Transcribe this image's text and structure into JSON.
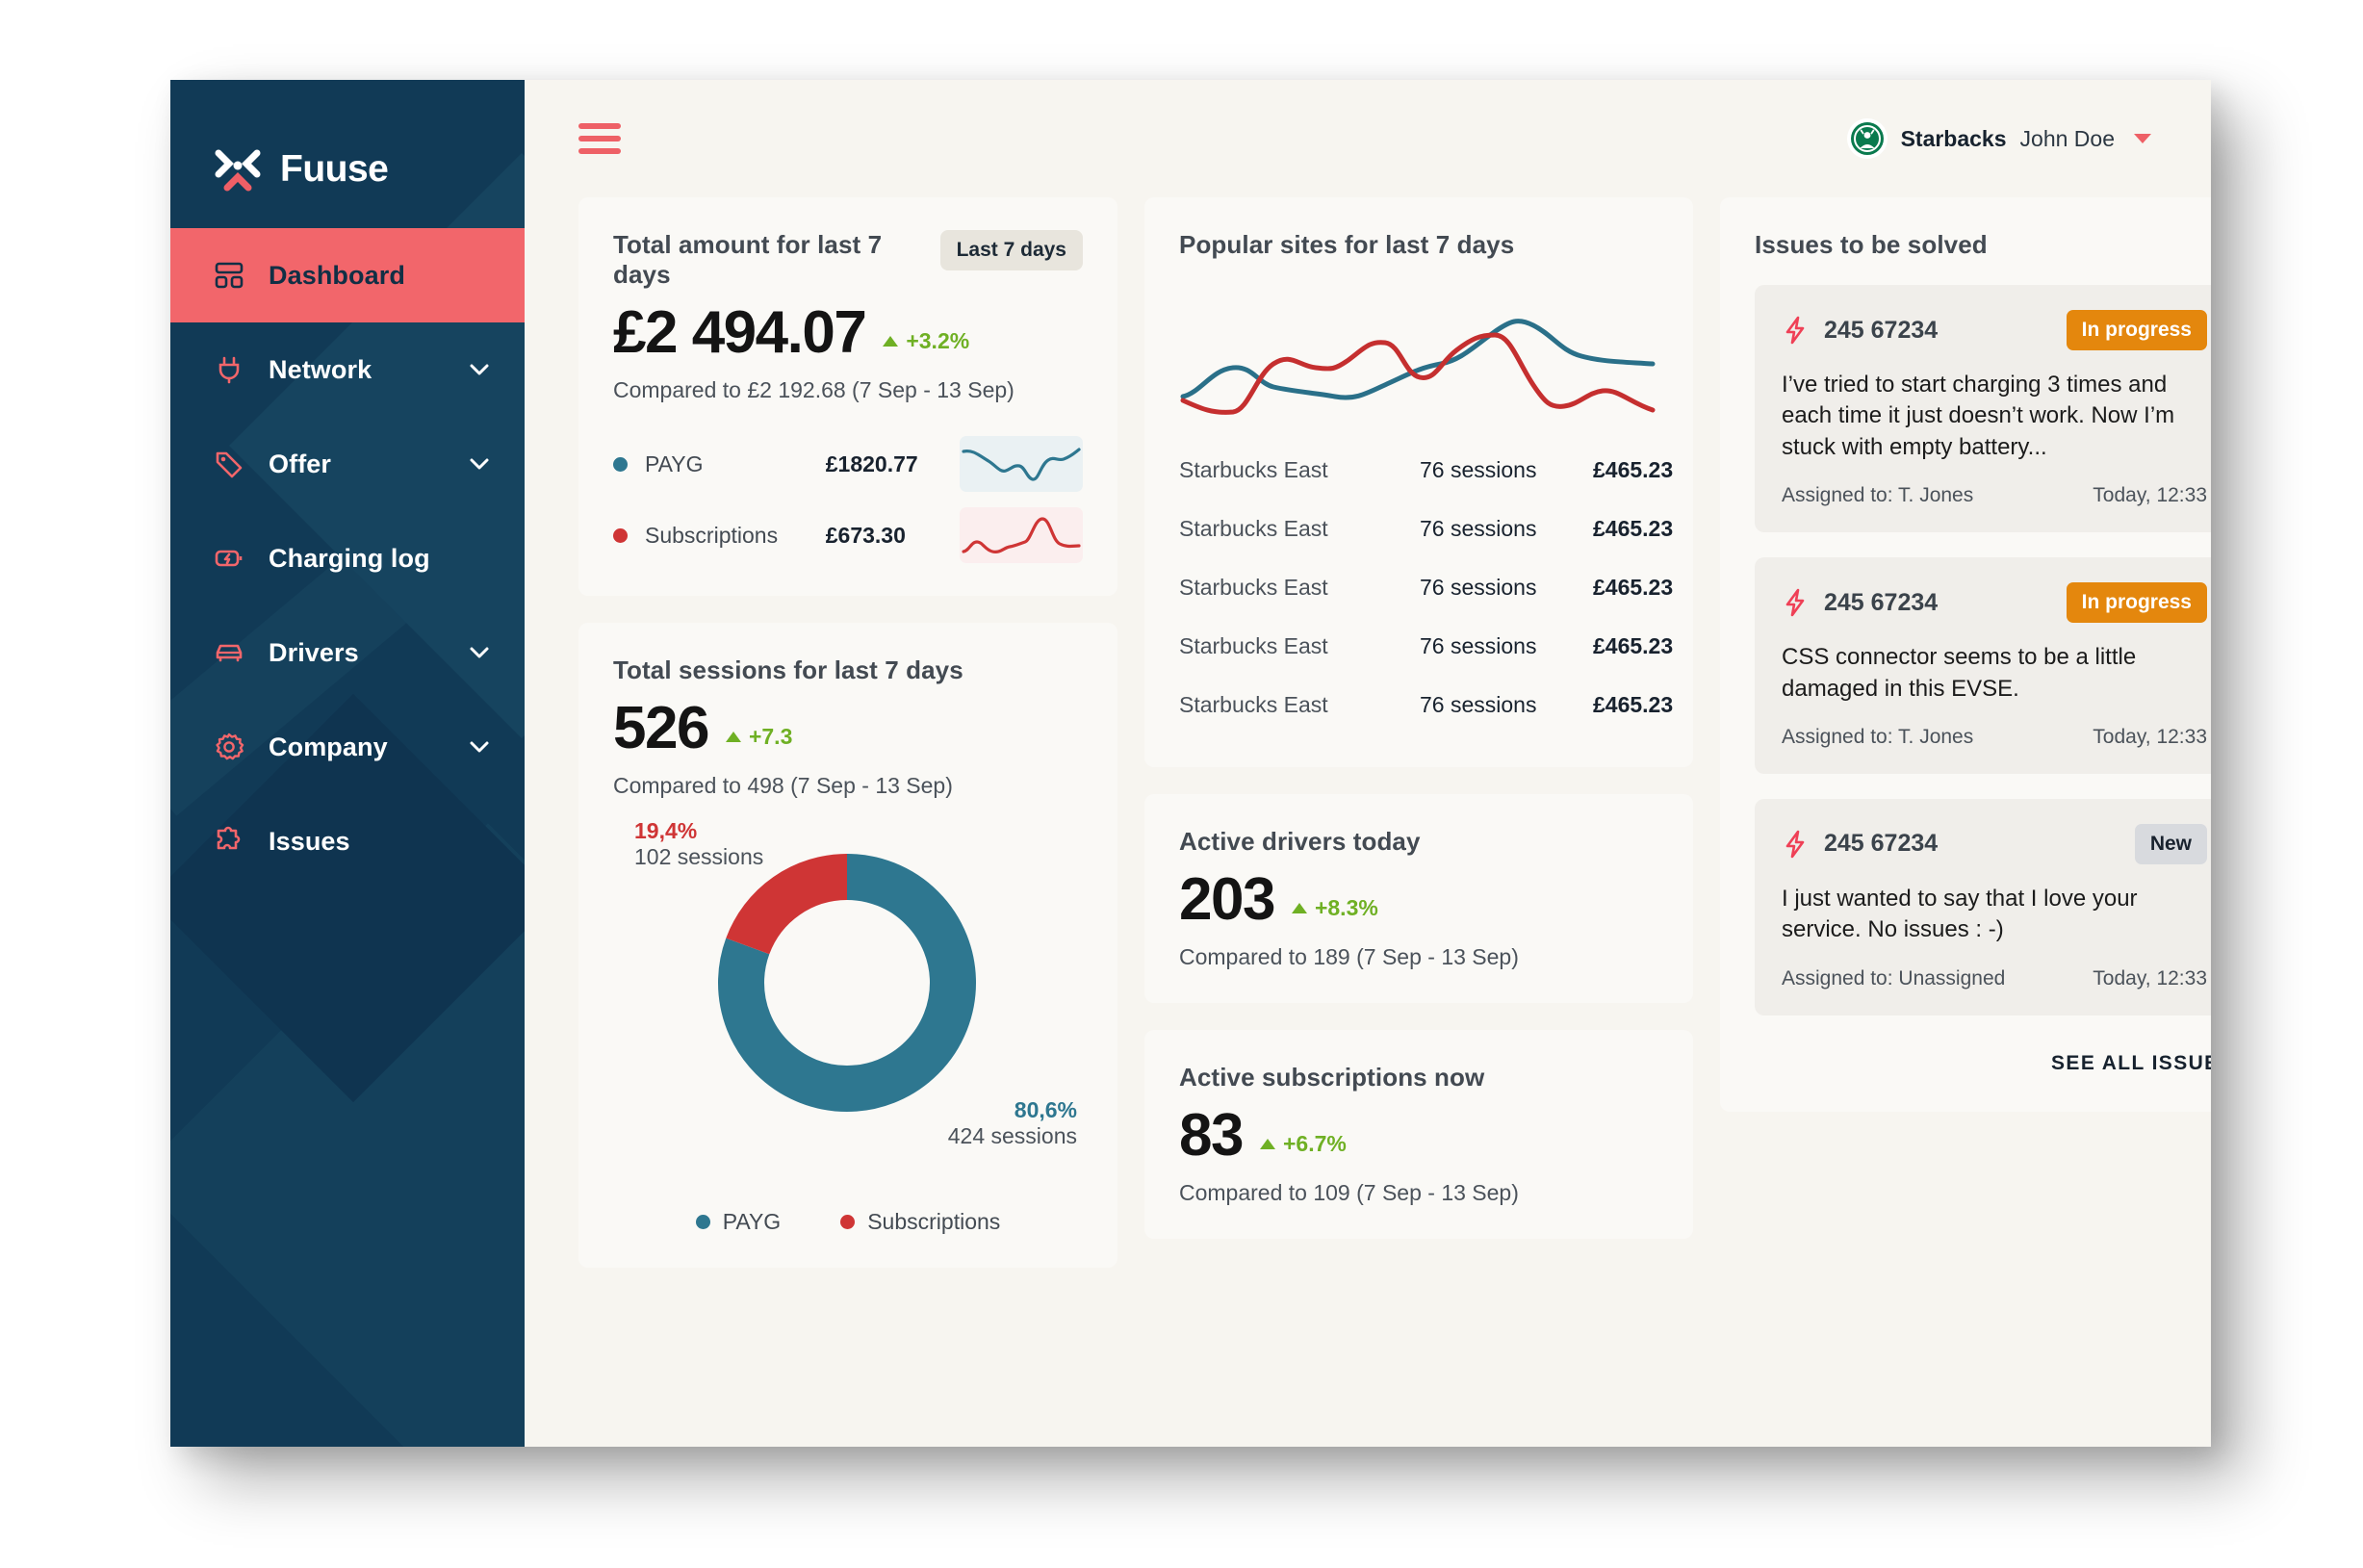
{
  "brand": {
    "name": "Fuuse",
    "logo_icon": "fuuse-x-logo"
  },
  "sidebar": {
    "items": [
      {
        "label": "Dashboard",
        "icon": "dashboard-grid-icon",
        "active": true,
        "expandable": false
      },
      {
        "label": "Network",
        "icon": "plug-icon",
        "active": false,
        "expandable": true
      },
      {
        "label": "Offer",
        "icon": "tag-icon",
        "active": false,
        "expandable": true
      },
      {
        "label": "Charging log",
        "icon": "battery-bolt-icon",
        "active": false,
        "expandable": false
      },
      {
        "label": "Drivers",
        "icon": "car-icon",
        "active": false,
        "expandable": true
      },
      {
        "label": "Company",
        "icon": "gear-icon",
        "active": false,
        "expandable": true
      },
      {
        "label": "Issues",
        "icon": "puzzle-icon",
        "active": false,
        "expandable": false
      }
    ]
  },
  "topbar": {
    "menu_icon": "hamburger-icon",
    "org": "Starbacks",
    "user": "John Doe",
    "avatar_icon": "starbucks-avatar"
  },
  "total_amount": {
    "title": "Total amount for last 7 days",
    "range_chip": "Last 7 days",
    "value": "£2 494.07",
    "delta": "+3.2%",
    "compared": "Compared to £2 192.68 (7 Sep - 13 Sep)",
    "breakdown": [
      {
        "name": "PAYG",
        "value": "£1820.77",
        "color": "#2e7790"
      },
      {
        "name": "Subscriptions",
        "value": "£673.30",
        "color": "#cf3535"
      }
    ]
  },
  "total_sessions": {
    "title": "Total sessions for last 7 days",
    "value": "526",
    "delta": "+7.3",
    "compared": "Compared to 498 (7 Sep - 13 Sep)",
    "labels": {
      "top_pct": "19,4%",
      "top_sessions": "102 sessions",
      "bottom_pct": "80,6%",
      "bottom_sessions": "424 sessions"
    },
    "legend": [
      {
        "name": "PAYG",
        "color": "#2e7790"
      },
      {
        "name": "Subscriptions",
        "color": "#cf3535"
      }
    ]
  },
  "popular_sites": {
    "title": "Popular sites for last 7 days",
    "rows": [
      {
        "site": "Starbucks East",
        "sessions": "76 sessions",
        "amount": "£465.23"
      },
      {
        "site": "Starbucks East",
        "sessions": "76 sessions",
        "amount": "£465.23"
      },
      {
        "site": "Starbucks East",
        "sessions": "76 sessions",
        "amount": "£465.23"
      },
      {
        "site": "Starbucks East",
        "sessions": "76 sessions",
        "amount": "£465.23"
      },
      {
        "site": "Starbucks East",
        "sessions": "76 sessions",
        "amount": "£465.23"
      }
    ]
  },
  "active_drivers": {
    "title": "Active drivers today",
    "value": "203",
    "delta": "+8.3%",
    "compared": "Compared to 189 (7 Sep - 13 Sep)"
  },
  "active_subscriptions": {
    "title": "Active subscriptions now",
    "value": "83",
    "delta": "+6.7%",
    "compared": "Compared to 109 (7 Sep - 13 Sep)"
  },
  "issues": {
    "title": "Issues to be solved",
    "see_all": "SEE ALL ISSUES",
    "items": [
      {
        "id": "245 67234",
        "status": "In progress",
        "status_kind": "progress",
        "text": "I’ve tried to start charging 3 times and each time it just doesn’t work. Now I’m stuck with empty battery...",
        "assigned": "Assigned to: T. Jones",
        "time": "Today, 12:33"
      },
      {
        "id": "245 67234",
        "status": "In progress",
        "status_kind": "progress",
        "text": "CSS connector seems to be a little damaged in this EVSE.",
        "assigned": "Assigned to: T. Jones",
        "time": "Today, 12:33"
      },
      {
        "id": "245 67234",
        "status": "New",
        "status_kind": "new",
        "text": "I just wanted to say that I love your service. No issues : -)",
        "assigned": "Assigned to: Unassigned",
        "time": "Today, 12:33"
      }
    ]
  },
  "colors": {
    "navy": "#113a56",
    "coral": "#f2666b",
    "teal": "#2e7790",
    "red": "#cf3535",
    "green": "#6fb024",
    "orange": "#e4870d",
    "canvas": "#f7f5f0",
    "card": "#faf9f6"
  },
  "chart_data": [
    {
      "type": "line",
      "name": "total-amount-payg-sparkline",
      "title": "PAYG",
      "x": [
        0,
        1,
        2,
        3,
        4,
        5,
        6,
        7,
        8,
        9,
        10
      ],
      "values": [
        78,
        74,
        58,
        44,
        52,
        50,
        26,
        34,
        62,
        56,
        72
      ],
      "color": "#2e7790",
      "grid": false,
      "legend": "none"
    },
    {
      "type": "line",
      "name": "total-amount-subscriptions-sparkline",
      "title": "Subscriptions",
      "x": [
        0,
        1,
        2,
        3,
        4,
        5,
        6,
        7,
        8,
        9,
        10
      ],
      "values": [
        18,
        38,
        30,
        28,
        38,
        42,
        46,
        92,
        60,
        52,
        48
      ],
      "color": "#cf3535",
      "grid": false,
      "legend": "none"
    },
    {
      "type": "pie",
      "name": "total-sessions-donut",
      "title": "Total sessions for last 7 days",
      "labels": [
        "Subscriptions",
        "PAYG"
      ],
      "values": [
        19.4,
        80.6
      ],
      "value_labels": [
        "102 sessions",
        "424 sessions"
      ],
      "colors": [
        "#cf3535",
        "#2e7790"
      ],
      "donut": true,
      "legend": "bottom"
    },
    {
      "type": "line",
      "name": "popular-sites-chart",
      "title": "Popular sites for last 7 days",
      "x": [
        0,
        1,
        2,
        3,
        4,
        5,
        6,
        7,
        8,
        9,
        10,
        11,
        12
      ],
      "series": [
        {
          "name": "series-teal",
          "color": "#2e7790",
          "values": [
            18,
            34,
            40,
            30,
            26,
            22,
            24,
            32,
            40,
            62,
            78,
            56,
            44
          ]
        },
        {
          "name": "series-red",
          "color": "#cf3535",
          "values": [
            20,
            12,
            8,
            42,
            50,
            44,
            62,
            46,
            44,
            66,
            70,
            22,
            14
          ]
        }
      ],
      "grid": false,
      "legend": "none",
      "axes": false
    }
  ]
}
